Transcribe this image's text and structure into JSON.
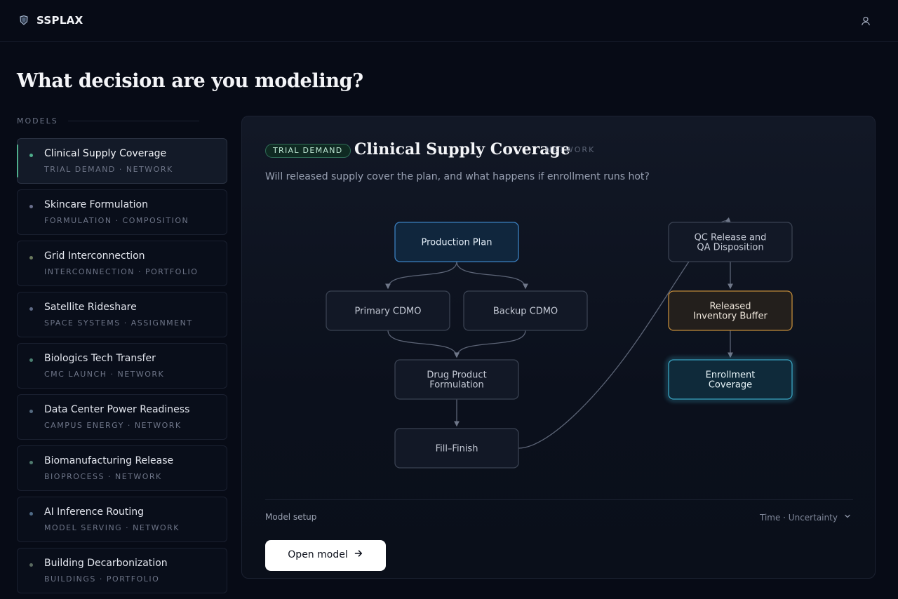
{
  "app": {
    "brand": "SSPLAX"
  },
  "page": {
    "title": "What decision are you modeling?"
  },
  "models": {
    "label": "MODELS",
    "items": [
      {
        "name": "Clinical Supply Coverage",
        "sub": "TRIAL DEMAND · NETWORK",
        "dot_color": "#4fae8c",
        "active": true
      },
      {
        "name": "Skincare Formulation",
        "sub": "FORMULATION · COMPOSITION",
        "dot_color": "#6a6f8c"
      },
      {
        "name": "Grid Interconnection",
        "sub": "INTERCONNECTION · PORTFOLIO",
        "dot_color": "#6b7a5e"
      },
      {
        "name": "Satellite Rideshare",
        "sub": "SPACE SYSTEMS · ASSIGNMENT",
        "dot_color": "#5e6a86"
      },
      {
        "name": "Biologics Tech Transfer",
        "sub": "CMC LAUNCH · NETWORK",
        "dot_color": "#4a7f70"
      },
      {
        "name": "Data Center Power Readiness",
        "sub": "CAMPUS ENERGY · NETWORK",
        "dot_color": "#546a80"
      },
      {
        "name": "Biomanufacturing Release",
        "sub": "BIOPROCESS · NETWORK",
        "dot_color": "#4f7a6e"
      },
      {
        "name": "AI Inference Routing",
        "sub": "MODEL SERVING · NETWORK",
        "dot_color": "#4f6a86"
      },
      {
        "name": "Building Decarbonization",
        "sub": "BUILDINGS · PORTFOLIO",
        "dot_color": "#5a6a60"
      }
    ]
  },
  "detail": {
    "tag": "TRIAL DEMAND",
    "title": "Clinical Supply Coverage",
    "kind": "NETWORK",
    "description": "Will released supply cover the plan, and what happens if enrollment runs hot?",
    "diagram": {
      "nodes": [
        {
          "id": "production-plan",
          "label": [
            "Production Plan"
          ],
          "style": "blue"
        },
        {
          "id": "primary-cdmo",
          "label": [
            "Primary CDMO"
          ],
          "style": "plain"
        },
        {
          "id": "backup-cdmo",
          "label": [
            "Backup CDMO"
          ],
          "style": "plain"
        },
        {
          "id": "drug-product-formulation",
          "label": [
            "Drug Product",
            "Formulation"
          ],
          "style": "plain"
        },
        {
          "id": "fill-finish",
          "label": [
            "Fill–Finish"
          ],
          "style": "plain"
        },
        {
          "id": "qc-release",
          "label": [
            "QC Release and",
            "QA Disposition"
          ],
          "style": "plain"
        },
        {
          "id": "released-inventory-buffer",
          "label": [
            "Released",
            "Inventory Buffer"
          ],
          "style": "amber"
        },
        {
          "id": "enrollment-coverage",
          "label": [
            "Enrollment",
            "Coverage"
          ],
          "style": "cyan"
        }
      ],
      "edges": [
        [
          "production-plan",
          "primary-cdmo"
        ],
        [
          "production-plan",
          "backup-cdmo"
        ],
        [
          "primary-cdmo",
          "drug-product-formulation"
        ],
        [
          "backup-cdmo",
          "drug-product-formulation"
        ],
        [
          "drug-product-formulation",
          "fill-finish"
        ],
        [
          "fill-finish",
          "qc-release"
        ],
        [
          "qc-release",
          "released-inventory-buffer"
        ],
        [
          "released-inventory-buffer",
          "enrollment-coverage"
        ]
      ]
    },
    "setup_label": "Model setup",
    "setup_options": "Time · Uncertainty",
    "open_label": "Open model"
  },
  "colors": {
    "accent": "#4fae8c",
    "blue_node": "#3b7fbf",
    "amber_node": "#c08a3a",
    "cyan_node": "#3aa6c4"
  }
}
